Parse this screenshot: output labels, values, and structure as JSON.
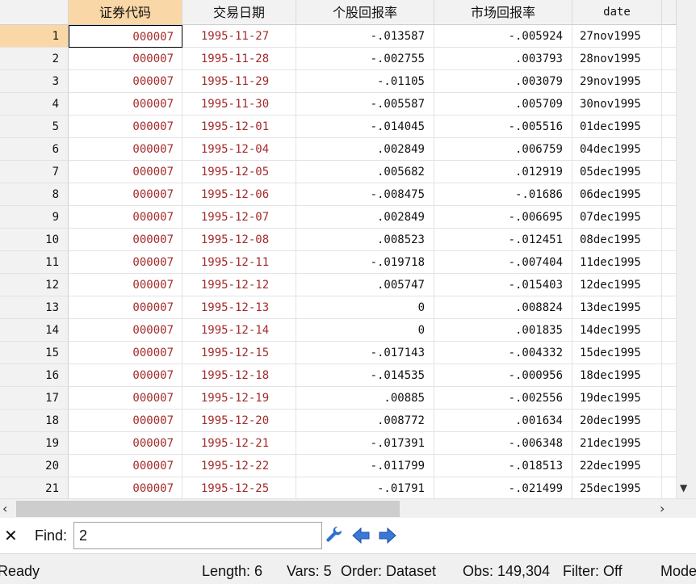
{
  "columns": [
    {
      "label": "证券代码"
    },
    {
      "label": "交易日期"
    },
    {
      "label": "个股回报率"
    },
    {
      "label": "市场回报率"
    },
    {
      "label": "date"
    }
  ],
  "rows": [
    {
      "n": "1",
      "code": "000007",
      "date": "1995-11-27",
      "ret": "-.013587",
      "mkt": "-.005924",
      "d": "27nov1995"
    },
    {
      "n": "2",
      "code": "000007",
      "date": "1995-11-28",
      "ret": "-.002755",
      "mkt": ".003793",
      "d": "28nov1995"
    },
    {
      "n": "3",
      "code": "000007",
      "date": "1995-11-29",
      "ret": "-.01105",
      "mkt": ".003079",
      "d": "29nov1995"
    },
    {
      "n": "4",
      "code": "000007",
      "date": "1995-11-30",
      "ret": "-.005587",
      "mkt": ".005709",
      "d": "30nov1995"
    },
    {
      "n": "5",
      "code": "000007",
      "date": "1995-12-01",
      "ret": "-.014045",
      "mkt": "-.005516",
      "d": "01dec1995"
    },
    {
      "n": "6",
      "code": "000007",
      "date": "1995-12-04",
      "ret": ".002849",
      "mkt": ".006759",
      "d": "04dec1995"
    },
    {
      "n": "7",
      "code": "000007",
      "date": "1995-12-05",
      "ret": ".005682",
      "mkt": ".012919",
      "d": "05dec1995"
    },
    {
      "n": "8",
      "code": "000007",
      "date": "1995-12-06",
      "ret": "-.008475",
      "mkt": "-.01686",
      "d": "06dec1995"
    },
    {
      "n": "9",
      "code": "000007",
      "date": "1995-12-07",
      "ret": ".002849",
      "mkt": "-.006695",
      "d": "07dec1995"
    },
    {
      "n": "10",
      "code": "000007",
      "date": "1995-12-08",
      "ret": ".008523",
      "mkt": "-.012451",
      "d": "08dec1995"
    },
    {
      "n": "11",
      "code": "000007",
      "date": "1995-12-11",
      "ret": "-.019718",
      "mkt": "-.007404",
      "d": "11dec1995"
    },
    {
      "n": "12",
      "code": "000007",
      "date": "1995-12-12",
      "ret": ".005747",
      "mkt": "-.015403",
      "d": "12dec1995"
    },
    {
      "n": "13",
      "code": "000007",
      "date": "1995-12-13",
      "ret": "0",
      "mkt": ".008824",
      "d": "13dec1995"
    },
    {
      "n": "14",
      "code": "000007",
      "date": "1995-12-14",
      "ret": "0",
      "mkt": ".001835",
      "d": "14dec1995"
    },
    {
      "n": "15",
      "code": "000007",
      "date": "1995-12-15",
      "ret": "-.017143",
      "mkt": "-.004332",
      "d": "15dec1995"
    },
    {
      "n": "16",
      "code": "000007",
      "date": "1995-12-18",
      "ret": "-.014535",
      "mkt": "-.000956",
      "d": "18dec1995"
    },
    {
      "n": "17",
      "code": "000007",
      "date": "1995-12-19",
      "ret": ".00885",
      "mkt": "-.002556",
      "d": "19dec1995"
    },
    {
      "n": "18",
      "code": "000007",
      "date": "1995-12-20",
      "ret": ".008772",
      "mkt": ".001634",
      "d": "20dec1995"
    },
    {
      "n": "19",
      "code": "000007",
      "date": "1995-12-21",
      "ret": "-.017391",
      "mkt": "-.006348",
      "d": "21dec1995"
    },
    {
      "n": "20",
      "code": "000007",
      "date": "1995-12-22",
      "ret": "-.011799",
      "mkt": "-.018513",
      "d": "22dec1995"
    },
    {
      "n": "21",
      "code": "000007",
      "date": "1995-12-25",
      "ret": "-.01791",
      "mkt": "-.021499",
      "d": "25dec1995"
    }
  ],
  "findbar": {
    "label": "Find:",
    "value": "2"
  },
  "status": {
    "ready": "Ready",
    "length": "Length: 6",
    "vars": "Vars: 5",
    "order": "Order: Dataset",
    "obs": "Obs: 149,304",
    "filter": "Filter: Off",
    "mode": "Mode"
  },
  "icons": {
    "close": "close-icon",
    "tools": "wrench-icon",
    "prev": "arrow-left-icon",
    "next": "arrow-right-icon"
  },
  "colors": {
    "string_text": "#a52a2a",
    "selected_header": "#f9d7a6",
    "arrow_blue": "#3a78d8"
  }
}
